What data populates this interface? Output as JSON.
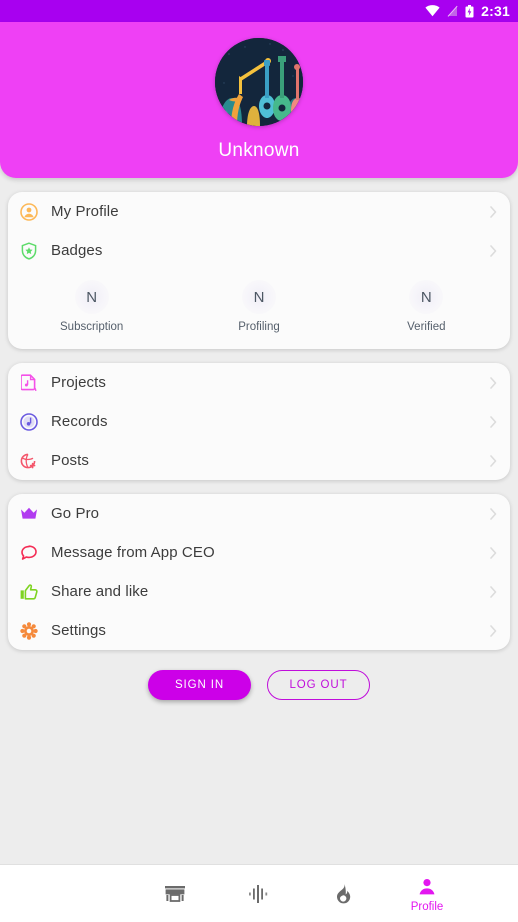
{
  "statusbar": {
    "time": "2:31",
    "icons": [
      "wifi-icon",
      "signal-off-icon",
      "battery-charging-icon"
    ],
    "background": "#a800f0"
  },
  "header": {
    "background": "#ef40f5",
    "avatar_alt": "musical-instruments-avatar",
    "username": "Unknown"
  },
  "cards": [
    {
      "rows": [
        {
          "icon": "person-circle-icon",
          "icon_color": "#fcb857",
          "label": "My Profile"
        },
        {
          "icon": "shield-star-icon",
          "icon_color": "#5ddb6a",
          "label": "Badges"
        }
      ],
      "stats": [
        {
          "value": "N",
          "label": "Subscription"
        },
        {
          "value": "N",
          "label": "Profiling"
        },
        {
          "value": "N",
          "label": "Verified"
        }
      ]
    },
    {
      "rows": [
        {
          "icon": "music-file-icon",
          "icon_color": "#f451e8",
          "label": "Projects"
        },
        {
          "icon": "record-disc-icon",
          "icon_color": "#6a5ae0",
          "label": "Records"
        },
        {
          "icon": "globe-post-icon",
          "icon_color": "#f4566b",
          "label": "Posts"
        }
      ]
    },
    {
      "rows": [
        {
          "icon": "crown-icon",
          "icon_color": "#b13bf0",
          "label": "Go Pro"
        },
        {
          "icon": "speech-bubble-icon",
          "icon_color": "#f42d55",
          "label": "Message from App CEO"
        },
        {
          "icon": "thumbs-up-icon",
          "icon_color": "#7ed321",
          "label": "Share and like"
        },
        {
          "icon": "gear-icon",
          "icon_color": "#f58a3c",
          "label": "Settings"
        }
      ]
    }
  ],
  "buttons": {
    "sign_in": "SIGN IN",
    "log_out": "LOG OUT",
    "filled_color": "#cc00e8",
    "outline_color": "#c00ddb"
  },
  "bottomnav": {
    "active_color": "#e316f0",
    "inactive_color": "#6b6b6b",
    "items": [
      {
        "icon": "store-icon",
        "label": "",
        "active": false
      },
      {
        "icon": "waveform-icon",
        "label": "",
        "active": false
      },
      {
        "icon": "flame-icon",
        "label": "",
        "active": false
      },
      {
        "icon": "person-icon",
        "label": "Profile",
        "active": true
      }
    ]
  }
}
